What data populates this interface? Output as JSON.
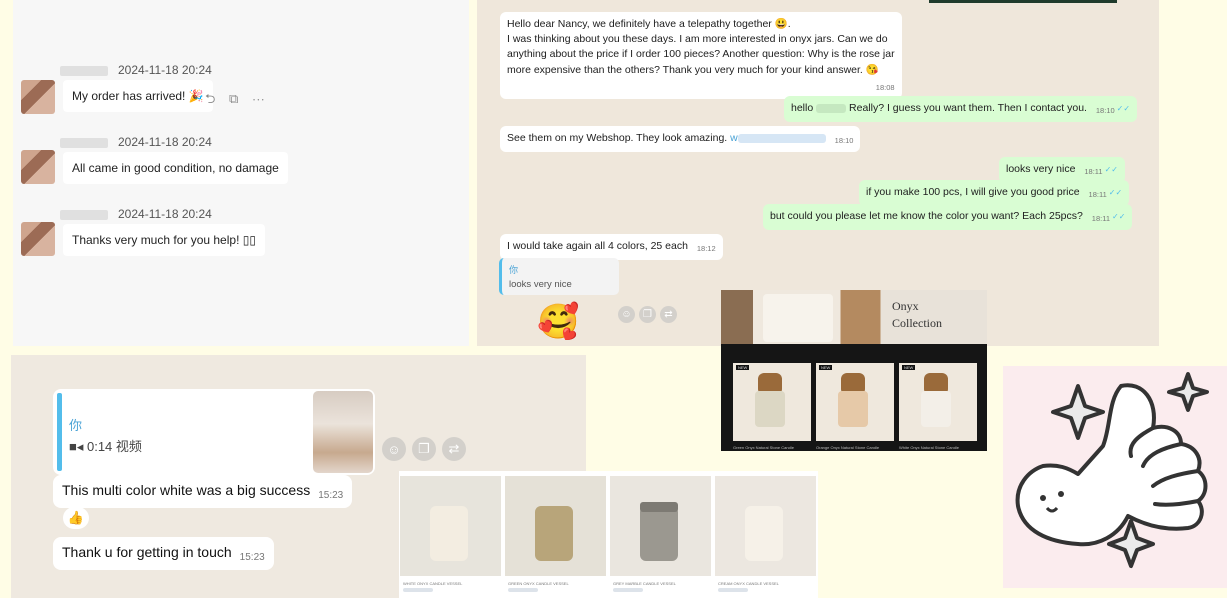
{
  "wechat": {
    "messages": [
      {
        "time": "2024-11-18 20:24",
        "text": "My order has arrived! 🎉"
      },
      {
        "time": "2024-11-18 20:24",
        "text": "All came in good condition, no damage"
      },
      {
        "time": "2024-11-18 20:24",
        "text": "Thanks very much for you help! ▯▯"
      }
    ],
    "tool_icons": "⮌ ⧉ ⋯"
  },
  "whatsapp": {
    "msg1": {
      "line1": "Hello dear Nancy, we definitely have a telepathy together 😃.",
      "line2": "I was thinking about you these days. I am more interested in onyx jars. Can we do",
      "line3": "anything about the price if I order 100 pieces? Another question: Why is the rose jar",
      "line4": "more expensive than the others? Thank you very much for your kind answer. 😘",
      "time": "18:08"
    },
    "msg2": {
      "prefix": "hello",
      "text": "Really? I guess you want them. Then I contact you.",
      "time": "18:10"
    },
    "msg3": {
      "text": "See them on my Webshop. They look amazing.",
      "prefix_link": "w",
      "time": "18:10"
    },
    "msg4": {
      "text": "looks very nice",
      "time": "18:11"
    },
    "msg5": {
      "text": "if you make 100 pcs, I will give you good price",
      "time": "18:11"
    },
    "msg6": {
      "text": "but could you please let me know the color you want? Each 25pcs?",
      "time": "18:11"
    },
    "msg7": {
      "text": "I would take again all 4 colors, 25 each",
      "time": "18:12"
    },
    "quote": {
      "author": "你",
      "text": "looks very nice"
    },
    "big_emoji": "🥰",
    "tick": "✓✓"
  },
  "onyx": {
    "title_line1": "Onyx",
    "title_line2": "Collection",
    "badge": "NEW",
    "captions": [
      "Green Onyx Natural Stone Candle",
      "Orange Onyx Natural Stone Candle",
      "White Onyx Natural Stone Candle"
    ]
  },
  "mobile_chat": {
    "quote_author": "你",
    "quote_video": "■◂ 0:14 视频",
    "msg1": {
      "text": "This multi color white was a big success",
      "time": "15:23"
    },
    "reaction": "👍",
    "msg2": {
      "text": "Thank u for getting in touch",
      "time": "15:23"
    }
  },
  "products": {
    "labels": [
      "WHITE ONYX CANDLE VESSEL",
      "GREEN ONYX CANDLE VESSEL",
      "GREY MARBLE CANDLE VESSEL",
      "CREAM ONYX CANDLE VESSEL"
    ]
  },
  "colors": {
    "whatsapp_out": "#d9fdd3",
    "whatsapp_bg": "#efe7db",
    "tick_blue": "#53bdeb",
    "page_bg": "#fffde6"
  }
}
